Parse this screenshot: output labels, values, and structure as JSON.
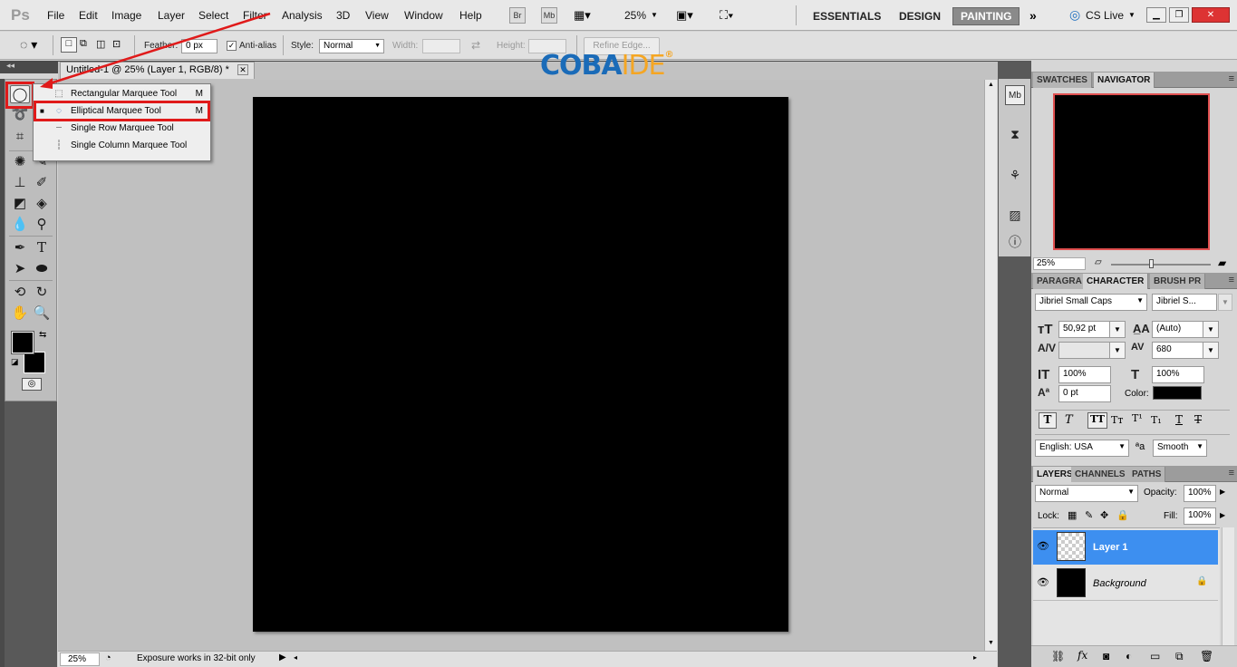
{
  "app": {
    "logo": "Ps"
  },
  "menubar": {
    "items": [
      "File",
      "Edit",
      "Image",
      "Layer",
      "Select",
      "Filter",
      "Analysis",
      "3D",
      "View",
      "Window",
      "Help"
    ],
    "br": "Br",
    "mb": "Mb",
    "zoom": "25%",
    "workspaces": {
      "essentials": "ESSENTIALS",
      "design": "DESIGN",
      "painting": "PAINTING"
    },
    "cslive": "CS Live"
  },
  "options": {
    "feather_label": "Feather:",
    "feather_value": "0 px",
    "antialias_label": "Anti-alias",
    "antialias_checked": true,
    "style_label": "Style:",
    "style_value": "Normal",
    "width_label": "Width:",
    "height_label": "Height:",
    "refine_edge": "Refine Edge..."
  },
  "document": {
    "tab_title": "Untitled-1 @ 25% (Layer 1, RGB/8) *"
  },
  "watermark": {
    "brand": "COBAIDE",
    "brand_part1": "COBA",
    "brand_part2": "IDE",
    "mark": "®"
  },
  "flyout": {
    "items": [
      {
        "label": "Rectangular Marquee Tool",
        "shortcut": "M"
      },
      {
        "label": "Elliptical Marquee Tool",
        "shortcut": "M",
        "selected": true
      },
      {
        "label": "Single Row Marquee Tool",
        "shortcut": ""
      },
      {
        "label": "Single Column Marquee Tool",
        "shortcut": ""
      }
    ]
  },
  "statusbar": {
    "zoom": "25%",
    "info": "Exposure works in 32-bit only"
  },
  "navigator": {
    "tabs": [
      "SWATCHES",
      "NAVIGATOR"
    ],
    "zoom": "25%"
  },
  "character": {
    "tabs": [
      "PARAGRA",
      "CHARACTER",
      "BRUSH PR"
    ],
    "font_family": "Jibriel Small Caps",
    "font_style": "Jibriel S...",
    "size": "50,92 pt",
    "leading": "(Auto)",
    "kerning": "",
    "tracking": "680",
    "vscale": "100%",
    "hscale": "100%",
    "baseline": "0 pt",
    "color_label": "Color:",
    "color_value": "#000000",
    "language": "English: USA",
    "aa_label": "ªa",
    "antialias": "Smooth"
  },
  "layers": {
    "tabs": [
      "LAYERS",
      "CHANNELS",
      "PATHS"
    ],
    "blend": "Normal",
    "opacity_label": "Opacity:",
    "opacity": "100%",
    "lock_label": "Lock:",
    "fill_label": "Fill:",
    "fill": "100%",
    "items": [
      {
        "name": "Layer 1",
        "selected": true
      },
      {
        "name": "Background",
        "locked": true
      }
    ]
  },
  "colors": {
    "accent_red": "#e01a1a",
    "selection_blue": "#3d8ff0",
    "watermark_blue": "#1a6bb8",
    "watermark_orange": "#f5a623"
  }
}
